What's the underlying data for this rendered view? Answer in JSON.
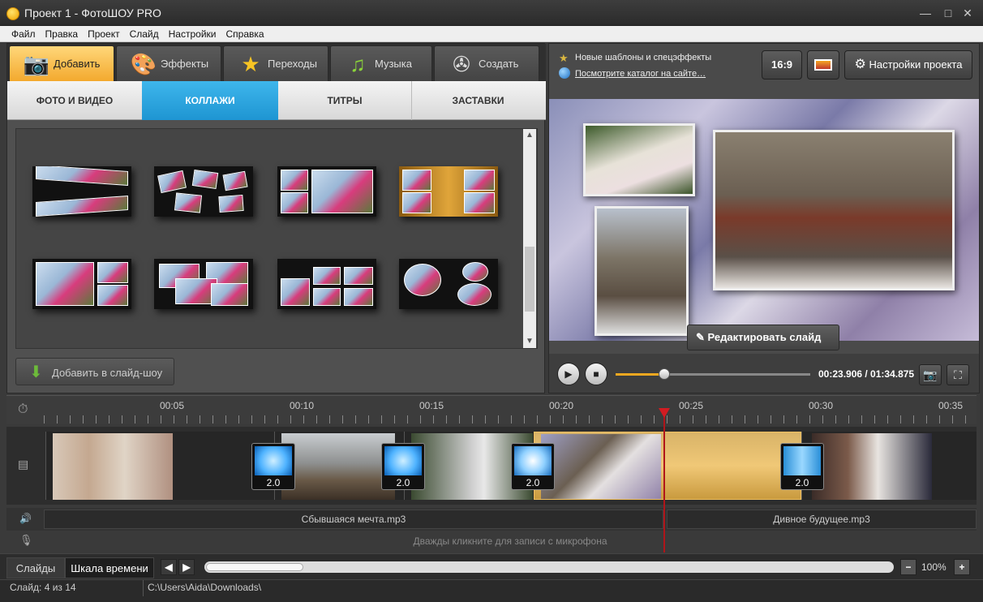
{
  "window": {
    "title": "Проект 1 - ФотоШОУ PRO",
    "minimize": "—",
    "maximize": "□",
    "close": "✕"
  },
  "menu": [
    "Файл",
    "Правка",
    "Проект",
    "Слайд",
    "Настройки",
    "Справка"
  ],
  "tabs": [
    {
      "label": "Добавить",
      "icon": "camera-icon"
    },
    {
      "label": "Эффекты",
      "icon": "palette-icon"
    },
    {
      "label": "Переходы",
      "icon": "star-icon"
    },
    {
      "label": "Музыка",
      "icon": "music-note-icon"
    },
    {
      "label": "Создать",
      "icon": "film-reel-icon"
    }
  ],
  "subtabs": [
    "ФОТО И ВИДЕО",
    "КОЛЛАЖИ",
    "ТИТРЫ",
    "ЗАСТАВКИ"
  ],
  "add_button": "Добавить в слайд-шоу",
  "promo": {
    "line1": "Новые шаблоны и спецэффекты",
    "link": "Посмотрите каталог на сайте…"
  },
  "right_buttons": {
    "ratio": "16:9",
    "settings": "Настройки проекта"
  },
  "edit_slide": "Редактировать слайд",
  "player": {
    "timecode": "00:23.906 / 01:34.875",
    "progress": 0.25
  },
  "ruler": [
    "00:05",
    "00:10",
    "00:15",
    "00:20",
    "00:25",
    "00:30",
    "00:35"
  ],
  "transitions": [
    "2.0",
    "2.0",
    "2.0",
    "2.0"
  ],
  "audio": [
    "Сбывшаяся мечта.mp3",
    "Дивное будущее.mp3"
  ],
  "mic_hint": "Дважды кликните для записи с микрофона",
  "bottom_tabs": [
    "Слайды",
    "Шкала времени"
  ],
  "zoom": {
    "minus": "−",
    "value": "100%",
    "plus": "+"
  },
  "status": {
    "slide": "Слайд: 4 из 14",
    "path": "C:\\Users\\Aida\\Downloads\\"
  },
  "colors": {
    "accent_orange": "#f3a92e",
    "accent_blue": "#1e95d2",
    "playhead": "#d21c22"
  }
}
